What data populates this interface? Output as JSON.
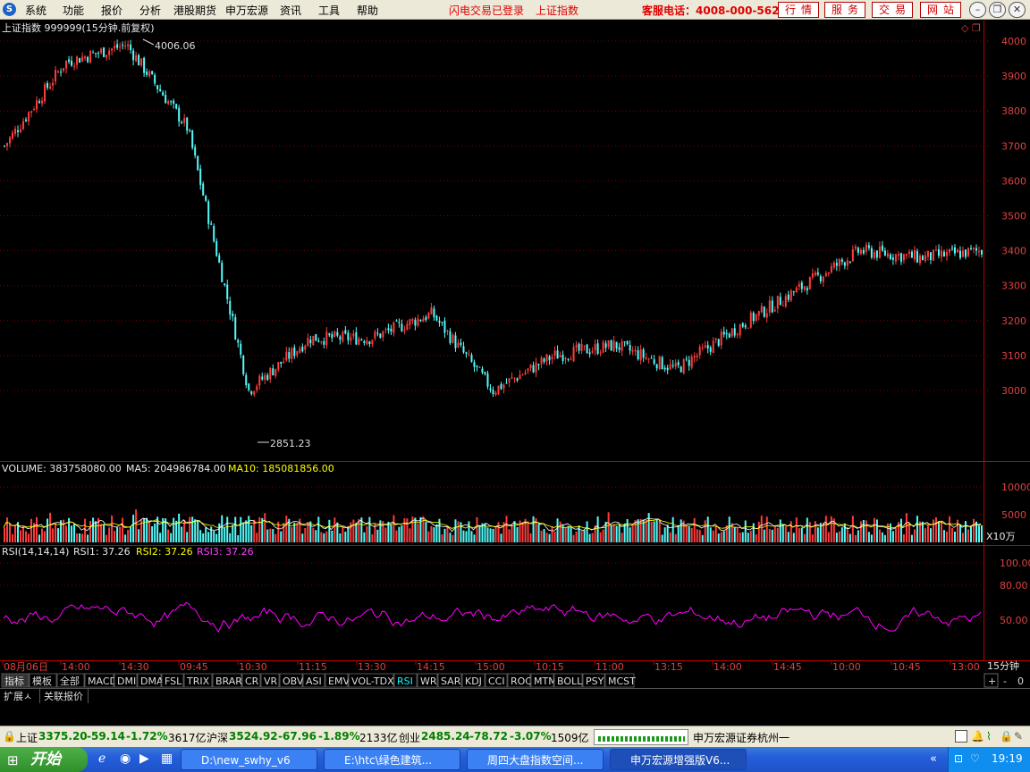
{
  "menu": {
    "items": [
      "系统",
      "功能",
      "报价",
      "分析",
      "港股期货",
      "申万宏源",
      "资讯",
      "工具",
      "帮助"
    ],
    "login_status": "闪电交易已登录",
    "current_index": "上证指数",
    "hotline": "客服电话：4008-000-562",
    "service_buttons": [
      "行情",
      "服务",
      "交易",
      "网站"
    ]
  },
  "price_panel": {
    "header": "上证指数 999999(15分钟.前复权)",
    "y_ticks": [
      3000,
      3100,
      3200,
      3300,
      3400,
      3500,
      3600,
      3700,
      3800,
      3900,
      4000
    ],
    "high_label": "4006.06",
    "low_label": "2851.23"
  },
  "volume_panel": {
    "label_volume": "VOLUME: 383758080.00",
    "label_ma5": "MA5: 204986784.00",
    "label_ma10": "MA10: 185081856.00",
    "y_ticks": [
      "5000",
      "10000"
    ],
    "unit": "X10万"
  },
  "rsi_panel": {
    "label_main": "RSI(14,14,14)",
    "label_rsi1": "RSI1: 37.26",
    "label_rsi2": "RSI2: 37.26",
    "label_rsi3": "RSI3: 37.26",
    "y_ticks": [
      "50.00",
      "80.00",
      "100.00"
    ]
  },
  "time_axis": {
    "labels": [
      "08月06日",
      "14:00",
      "14:30",
      "09:45",
      "10:30",
      "11:15",
      "13:30",
      "14:15",
      "15:00",
      "10:15",
      "11:00",
      "13:15",
      "14:00",
      "14:45",
      "10:00",
      "10:45",
      "13:00"
    ],
    "period": "15分钟"
  },
  "indicator_tabs": {
    "side": [
      "指标",
      "模板",
      "全部"
    ],
    "items": [
      "MACD",
      "DMI",
      "DMA",
      "FSL",
      "TRIX",
      "BRAR",
      "CR",
      "VR",
      "OBV",
      "ASI",
      "EMV",
      "VOL-TDX",
      "RSI",
      "WR",
      "SAR",
      "KDJ",
      "CCI",
      "ROC",
      "MTM",
      "BOLL",
      "PSY",
      "MCST"
    ],
    "active": "RSI",
    "controls": [
      "+",
      "-",
      "0"
    ]
  },
  "extra_tabs": [
    "扩展ㅅ",
    "关联报价"
  ],
  "status": {
    "sh_name": "上证",
    "sh_price": "3375.20",
    "sh_change": "-59.14",
    "sh_pct": "-1.72%",
    "sh_amount": "3617亿",
    "hs_name": "沪深",
    "hs_price": "3524.92",
    "hs_change": "-67.96",
    "hs_pct": "-1.89%",
    "hs_amount": "2133亿",
    "cy_name": "创业",
    "cy_price": "2485.24",
    "cy_change": "-78.72",
    "cy_pct": "-3.07%",
    "cy_amount": "1509亿",
    "broker": "申万宏源证券杭州一"
  },
  "taskbar": {
    "start": "开始",
    "tasks": [
      "D:\\new_swhy_v6",
      "E:\\htc\\绿色建筑...",
      "周四大盘指数空间...",
      "申万宏源增强版V6..."
    ],
    "clock": "19:19"
  },
  "chart_data": {
    "type": "candlestick",
    "price_range": [
      2851.23,
      4006.06
    ],
    "close_path_approx": [
      {
        "t": "08月06日",
        "v": 3700
      },
      {
        "t": "14:00",
        "v": 3940
      },
      {
        "t": "14:30",
        "v": 3990
      },
      {
        "t": "09:45",
        "v": 3750
      },
      {
        "t": "10:30",
        "v": 3000
      },
      {
        "t": "11:15",
        "v": 3150
      },
      {
        "t": "13:30",
        "v": 3150
      },
      {
        "t": "14:15",
        "v": 3220
      },
      {
        "t": "15:00",
        "v": 3000
      },
      {
        "t": "10:15",
        "v": 3100
      },
      {
        "t": "11:00",
        "v": 3130
      },
      {
        "t": "13:15",
        "v": 3060
      },
      {
        "t": "14:00",
        "v": 3180
      },
      {
        "t": "14:45",
        "v": 3290
      },
      {
        "t": "10:00",
        "v": 3400
      },
      {
        "t": "10:45",
        "v": 3380
      },
      {
        "t": "13:00",
        "v": 3400
      }
    ],
    "colors": {
      "up": "#ff3c3c",
      "down": "#54fcfc",
      "ma5": "#ffffff",
      "ma10": "#ffff00",
      "rsi": "#ff00ff",
      "grid": "#7a0000",
      "axis": "#c00000"
    }
  }
}
